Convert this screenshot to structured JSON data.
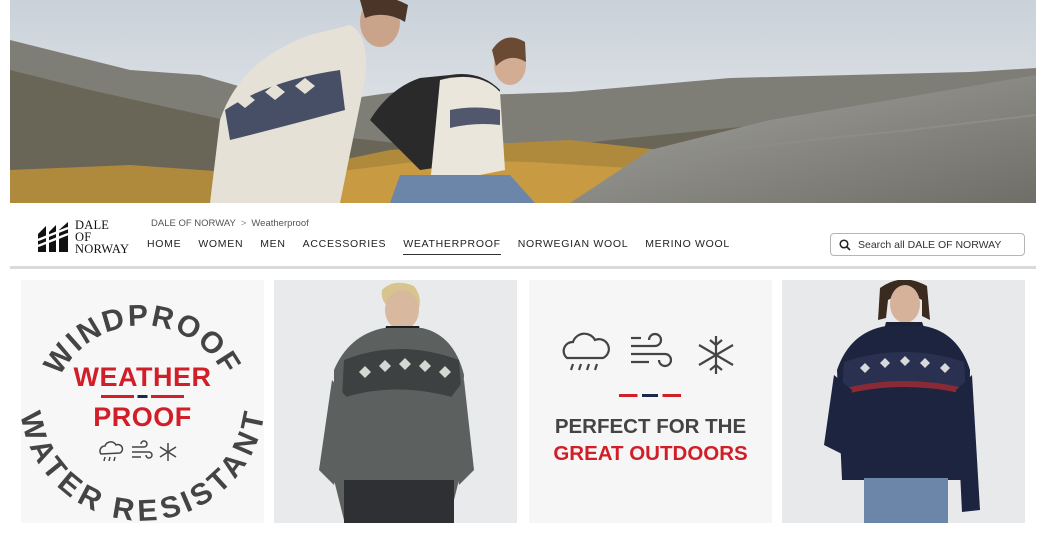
{
  "hero": {
    "image": "hikers-in-nordic-sweaters-mountain-scene"
  },
  "brand": {
    "line1": "DALE",
    "line2": "OF",
    "line3": "NORWAY",
    "logo_icon": "dale-logo-icon"
  },
  "breadcrumb": {
    "root": "DALE OF NORWAY",
    "separator": ">",
    "current": "Weatherproof"
  },
  "menu": {
    "items": [
      {
        "label": "HOME"
      },
      {
        "label": "WOMEN"
      },
      {
        "label": "MEN"
      },
      {
        "label": "ACCESSORIES"
      },
      {
        "label": "WEATHERPROOF",
        "active": true
      },
      {
        "label": "NORWEGIAN WOOL"
      },
      {
        "label": "MERINO WOOL"
      }
    ]
  },
  "search": {
    "placeholder": "Search all DALE OF NORWAY",
    "icon": "search-icon"
  },
  "tiles": {
    "badge": {
      "top_arc": "WINDPROOF",
      "line1": "WEATHER",
      "line2": "PROOF",
      "bottom_arc": "WATER RESISTANT"
    },
    "outdoors": {
      "line1": "PERFECT FOR THE",
      "line2": "GREAT OUTDOORS"
    }
  },
  "colors": {
    "accent_red": "#d01f28",
    "navy": "#1a2a4a",
    "text_gray": "#444444"
  }
}
